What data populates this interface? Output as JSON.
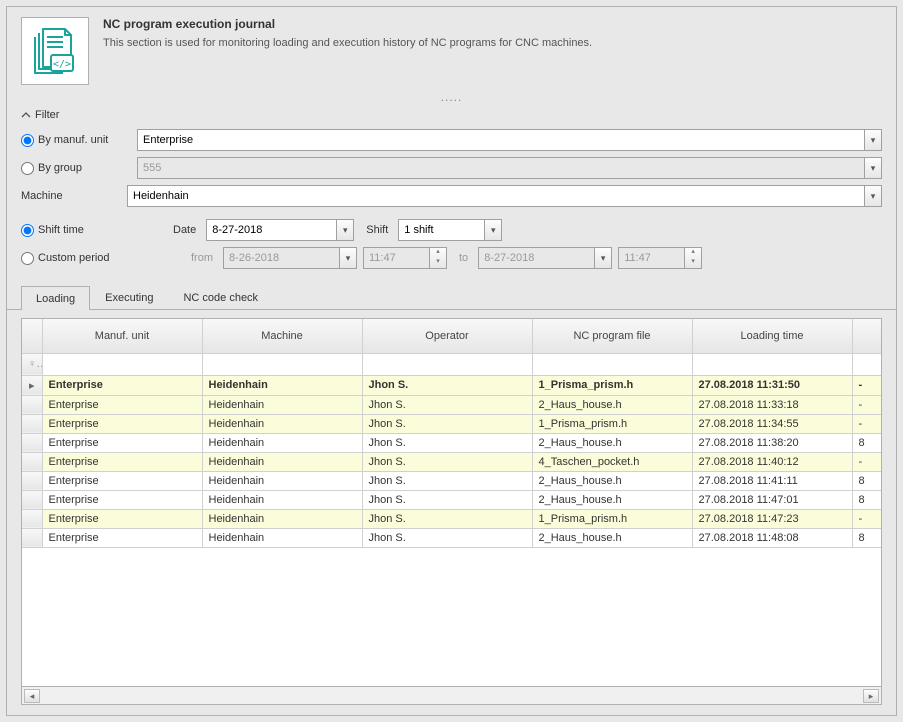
{
  "header": {
    "title": "NC program execution journal",
    "description": "This section is used for monitoring loading and execution history of NC programs for CNC machines."
  },
  "filter": {
    "header_label": "Filter",
    "by_manuf_label": "By manuf. unit",
    "by_group_label": "By group",
    "manuf_unit_value": "Enterprise",
    "group_value": "555",
    "machine_label": "Machine",
    "machine_value": "Heidenhain",
    "shift_time_label": "Shift time",
    "custom_period_label": "Custom period",
    "date_label": "Date",
    "date_value": "8-27-2018",
    "shift_label": "Shift",
    "shift_value": "1 shift",
    "from_label": "from",
    "from_date": "8-26-2018",
    "from_time": "11:47",
    "to_label": "to",
    "to_date": "8-27-2018",
    "to_time": "11:47"
  },
  "tabs": [
    {
      "label": "Loading",
      "active": true
    },
    {
      "label": "Executing",
      "active": false
    },
    {
      "label": "NC code check",
      "active": false
    }
  ],
  "grid": {
    "columns": [
      "Manuf. unit",
      "Machine",
      "Operator",
      "NC program file",
      "Loading time",
      ""
    ],
    "filter_icon": "♀",
    "rows": [
      {
        "selected": true,
        "alt": true,
        "cells": [
          "Enterprise",
          "Heidenhain",
          "Jhon S.",
          "1_Prisma_prism.h",
          "27.08.2018 11:31:50",
          "-"
        ]
      },
      {
        "selected": false,
        "alt": true,
        "cells": [
          "Enterprise",
          "Heidenhain",
          "Jhon S.",
          "2_Haus_house.h",
          "27.08.2018 11:33:18",
          "-"
        ]
      },
      {
        "selected": false,
        "alt": true,
        "cells": [
          "Enterprise",
          "Heidenhain",
          "Jhon S.",
          "1_Prisma_prism.h",
          "27.08.2018 11:34:55",
          "-"
        ]
      },
      {
        "selected": false,
        "alt": false,
        "cells": [
          "Enterprise",
          "Heidenhain",
          "Jhon S.",
          "2_Haus_house.h",
          "27.08.2018 11:38:20",
          "8"
        ]
      },
      {
        "selected": false,
        "alt": true,
        "cells": [
          "Enterprise",
          "Heidenhain",
          "Jhon S.",
          "4_Taschen_pocket.h",
          "27.08.2018 11:40:12",
          "-"
        ]
      },
      {
        "selected": false,
        "alt": false,
        "cells": [
          "Enterprise",
          "Heidenhain",
          "Jhon S.",
          "2_Haus_house.h",
          "27.08.2018 11:41:11",
          "8"
        ]
      },
      {
        "selected": false,
        "alt": false,
        "cells": [
          "Enterprise",
          "Heidenhain",
          "Jhon S.",
          "2_Haus_house.h",
          "27.08.2018 11:47:01",
          "8"
        ]
      },
      {
        "selected": false,
        "alt": true,
        "cells": [
          "Enterprise",
          "Heidenhain",
          "Jhon S.",
          "1_Prisma_prism.h",
          "27.08.2018 11:47:23",
          "-"
        ]
      },
      {
        "selected": false,
        "alt": false,
        "cells": [
          "Enterprise",
          "Heidenhain",
          "Jhon S.",
          "2_Haus_house.h",
          "27.08.2018 11:48:08",
          "8"
        ]
      }
    ]
  }
}
